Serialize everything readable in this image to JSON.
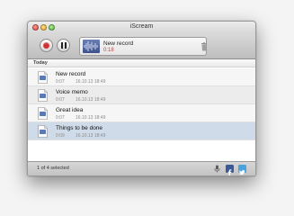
{
  "window": {
    "title": "iScream"
  },
  "toolbar": {
    "now_playing_name": "New record",
    "now_playing_time": "0:18"
  },
  "list": {
    "section_header": "Today",
    "items": [
      {
        "name": "New record",
        "duration": "0:07",
        "date": "16.10.13 18:49"
      },
      {
        "name": "Voice memo",
        "duration": "0:07",
        "date": "16.10.13 18:49"
      },
      {
        "name": "Great idea",
        "duration": "0:07",
        "date": "16.10.13 18:49"
      },
      {
        "name": "Things to be done",
        "duration": "0:09",
        "date": "16.10.13 18:49"
      }
    ],
    "selected_index": 3
  },
  "status": {
    "selection_text": "1 of 4 selected"
  },
  "colors": {
    "accent_red": "#d23b3b",
    "selection": "#cfdbe8",
    "facebook": "#3b5998",
    "twitter": "#4aa3df"
  },
  "icons": [
    "record-icon",
    "pause-icon",
    "waveform-icon",
    "trash-icon",
    "audio-file-icon",
    "microphone-icon",
    "facebook-icon",
    "twitter-icon"
  ]
}
